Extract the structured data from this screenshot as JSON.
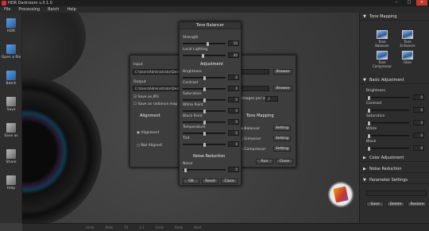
{
  "window": {
    "title": "HDR Darkroom v.3.1.0",
    "controls": [
      "–",
      "□",
      "✕"
    ]
  },
  "menu": [
    "File",
    "Processing",
    "Batch",
    "Help"
  ],
  "toolbar": [
    {
      "label": "HDR",
      "icon": "hdr-icon"
    },
    {
      "label": "Open a file",
      "icon": "open-file-icon"
    },
    {
      "label": "Batch",
      "icon": "batch-icon"
    },
    {
      "label": "Save",
      "icon": "save-icon"
    },
    {
      "label": "Save as",
      "icon": "save-as-icon"
    },
    {
      "label": "Share",
      "icon": "share-icon"
    },
    {
      "label": "Help",
      "icon": "help-icon"
    }
  ],
  "batch_dialog": {
    "input_label": "Input",
    "input_path": "C:\\Users\\Administrator\\Deskto",
    "output_label": "Output",
    "output_path": "C:\\Users\\Administrator\\Deskto",
    "browse_label": "Browse",
    "save_jpg": "Save as JPG",
    "save_radiance": "Save as radiance map (.hdr",
    "images_per_set_label": "Images per set",
    "images_per_set_value": "3",
    "alignment_header": "Alignment",
    "aligned": "Alignment",
    "not_aligned": "Not Aligned",
    "tone_mapping_header": "Tone Mapping",
    "tm_options": [
      "Balancer",
      "Enhancer",
      "Compressor"
    ],
    "setting_label": "Setting",
    "ok_label": "Run",
    "close_label": "Close"
  },
  "tone_balancer": {
    "title": "Tone Balancer",
    "strength_label": "Strength",
    "strength_value": "50",
    "local_label": "Local Lighting",
    "local_value": "40",
    "adjustment_header": "Adjustment",
    "adjustments": [
      {
        "label": "Brightness",
        "value": "0"
      },
      {
        "label": "Contrast",
        "value": "0"
      },
      {
        "label": "Saturation",
        "value": "0"
      },
      {
        "label": "White Point",
        "value": "0"
      },
      {
        "label": "Black Point",
        "value": "0"
      },
      {
        "label": "Temperature",
        "value": "0"
      },
      {
        "label": "Tint",
        "value": "0"
      }
    ],
    "noise_header": "Noise Reduction",
    "noise_label": "Noise",
    "noise_value": "0",
    "buttons": [
      "OK",
      "Reset",
      "Close"
    ]
  },
  "right_panel": {
    "tone_mapping_title": "Tone Mapping",
    "tone_presets": [
      "Tone Balancer",
      "Tone Enhancer",
      "Tone Compressor",
      "Fibre"
    ],
    "basic_adjustment_title": "Basic Adjustment",
    "basic": [
      {
        "label": "Brightness",
        "value": "0"
      },
      {
        "label": "Contrast",
        "value": "0"
      },
      {
        "label": "Saturation",
        "value": "0"
      },
      {
        "label": "White",
        "value": "0"
      },
      {
        "label": "Black",
        "value": "0"
      }
    ],
    "color_adjustment_title": "Color Adjustment",
    "noise_reduction_title": "Noise Reduction",
    "parameter_settings_title": "Parameter Settings",
    "param_buttons": [
      "Save",
      "Delete",
      "Restore"
    ]
  },
  "statusbar": [
    "Undo",
    "Redo",
    "Fit",
    "1:1",
    "Undo",
    "Redo",
    "Next"
  ]
}
